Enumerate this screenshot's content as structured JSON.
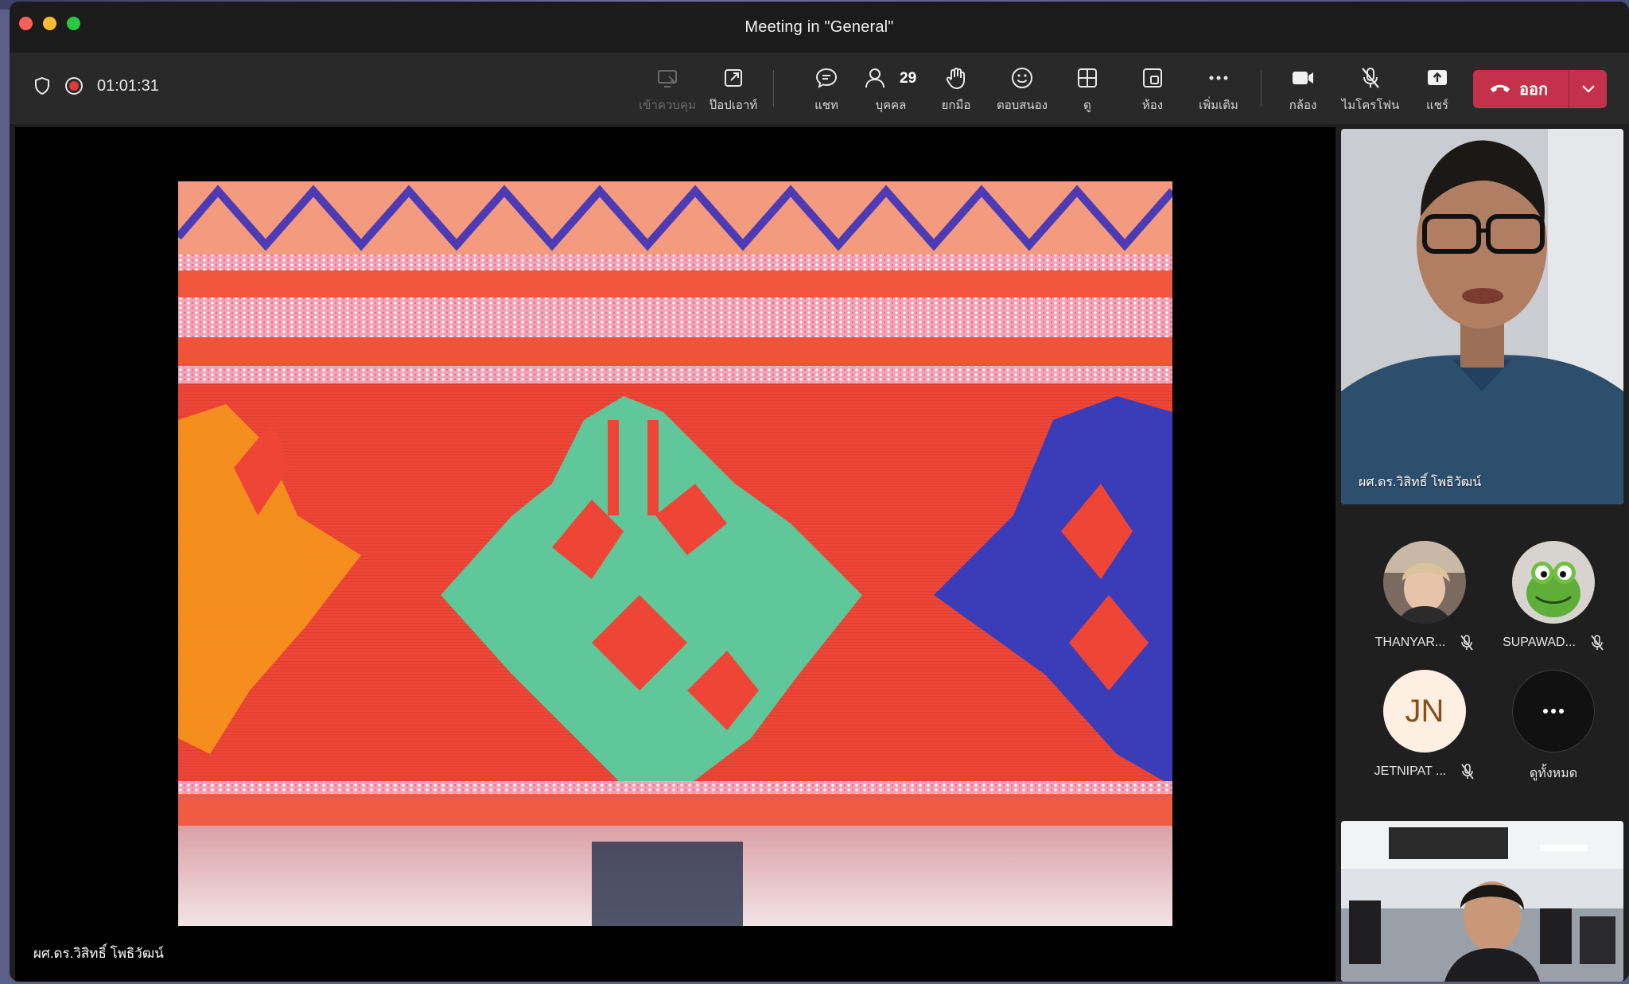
{
  "window": {
    "title": "Meeting in \"General\""
  },
  "toolbar": {
    "timer": "01:01:31",
    "items": [
      {
        "label": "เข้าควบคุม"
      },
      {
        "label": "ป๊อปเอาท์"
      },
      {
        "label": "แชท"
      },
      {
        "label": "บุคคล",
        "count": "29"
      },
      {
        "label": "ยกมือ"
      },
      {
        "label": "ตอบสนอง"
      },
      {
        "label": "ดู"
      },
      {
        "label": "ห้อง"
      },
      {
        "label": "เพิ่มเติม"
      },
      {
        "label": "กล้อง"
      },
      {
        "label": "ไมโครโฟน"
      },
      {
        "label": "แชร์"
      }
    ],
    "leave_label": "ออก"
  },
  "stage": {
    "presenter_name": "ผศ.ดร.วิสิทธิ์ โพธิวัฒน์"
  },
  "roster": {
    "speaker_name": "ผศ.ดร.วิสิทธิ์ โพธิวัฒน์",
    "tiles": [
      {
        "name": "THANYAR..."
      },
      {
        "name": "SUPAWAD..."
      },
      {
        "name": "JETNIPAT ...",
        "initials": "JN"
      },
      {
        "name": "ดูทั้งหมด"
      }
    ]
  },
  "colors": {
    "leave": "#c4314b",
    "record": "#e0393e",
    "toolbar": "#292929"
  }
}
